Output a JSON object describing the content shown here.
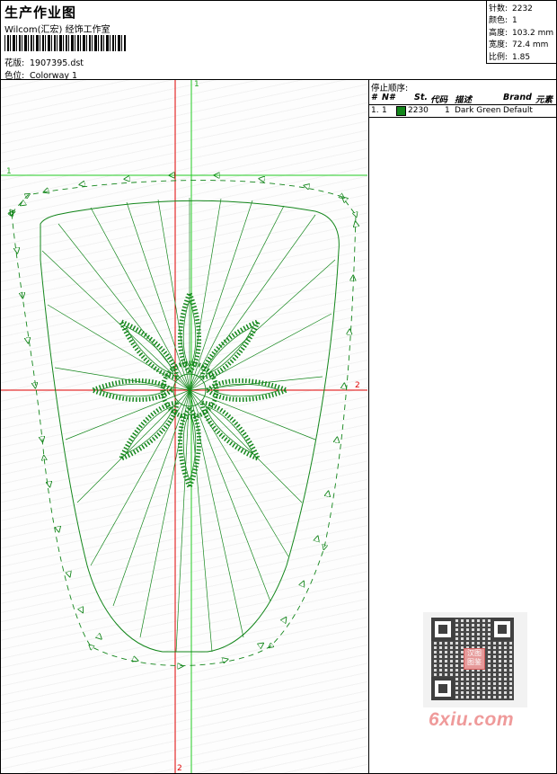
{
  "header": {
    "title": "生产作业图",
    "company": "Wilcom(汇宏) 经饰工作室",
    "design_label": "花版:",
    "design_value": "1907395.dst",
    "colorway_label": "色位:",
    "colorway_value": "Colorway 1"
  },
  "stats": [
    {
      "label": "针数:",
      "value": "2232"
    },
    {
      "label": "颜色:",
      "value": "1"
    },
    {
      "label": "高度:",
      "value": "103.2 mm"
    },
    {
      "label": "宽度:",
      "value": "72.4 mm"
    },
    {
      "label": "比例:",
      "value": "1.85"
    }
  ],
  "stop_sequence": {
    "title": "停止顺序:",
    "columns": [
      "#",
      "N#",
      "St.",
      "代码",
      "描述",
      "Brand",
      "元素"
    ],
    "rows": [
      {
        "num": "1.",
        "n": "1",
        "stitches": "2230",
        "code": "1",
        "description": "Dark Green",
        "brand": "Default",
        "element": ""
      }
    ]
  },
  "axis_labels": {
    "top": "1",
    "left": "1",
    "right": "2",
    "bottom": "2"
  },
  "colors": {
    "thread": "#13861b",
    "axis_red": "#e00000",
    "axis_green": "#22cc22"
  },
  "watermark": {
    "seal_text": "汉图 图鉴",
    "site": "6xiu.com"
  }
}
